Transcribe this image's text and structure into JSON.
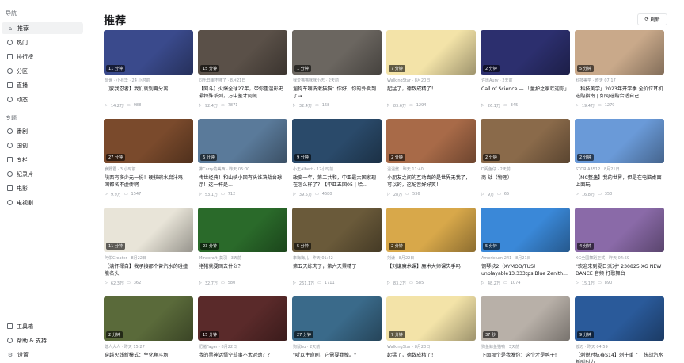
{
  "sidebar": {
    "nav_title": "导航",
    "nav": [
      {
        "label": "推荐",
        "icon": "home-icon"
      },
      {
        "label": "热门",
        "icon": "fire-icon"
      },
      {
        "label": "排行榜",
        "icon": "ranking-icon"
      },
      {
        "label": "分区",
        "icon": "category-icon"
      },
      {
        "label": "直播",
        "icon": "live-icon"
      },
      {
        "label": "动态",
        "icon": "activity-icon"
      }
    ],
    "zone_title": "专题",
    "zones": [
      {
        "label": "番剧",
        "icon": "anime-icon"
      },
      {
        "label": "国创",
        "icon": "guochuang-icon"
      },
      {
        "label": "专栏",
        "icon": "article-icon"
      },
      {
        "label": "纪录片",
        "icon": "documentary-icon"
      },
      {
        "label": "电影",
        "icon": "movie-icon"
      },
      {
        "label": "电视剧",
        "icon": "tv-icon"
      }
    ],
    "bottom": [
      {
        "label": "工具箱",
        "icon": "toolbox-icon"
      },
      {
        "label": "帮助 & 支持",
        "icon": "help-icon"
      },
      {
        "label": "设置",
        "icon": "settings-icon"
      }
    ]
  },
  "main": {
    "title": "推荐",
    "refresh_label": "刷新"
  },
  "videos": [
    {
      "duration": "11 分钟",
      "meta": "玩世 · 小孔华 · 24 小时前",
      "title": "【欧我忍者】我们就别再分离",
      "views": "14.2万",
      "danmaku": "988",
      "color": "#3a4a8c"
    },
    {
      "duration": "15 分钟",
      "meta": "同乐日审不够了 · 8月21日",
      "title": "【网斗】火爆全球27年，带你重温影史最特殊系列，万中鉴才阿凯...",
      "views": "92.4万",
      "danmaku": "7871",
      "color": "#5a5048"
    },
    {
      "duration": "1 分钟",
      "meta": "我爱猫猫咪咪小志 · 2天前",
      "title": "遛狗车嘴洗漱猫猫：你好，你的外卖到了→",
      "views": "32.4万",
      "danmaku": "168",
      "color": "#6b6660"
    },
    {
      "duration": "7 分钟",
      "meta": "WalkingStar · 8月20日",
      "title": "起猛了，德数成精了！",
      "views": "83.6万",
      "danmaku": "1294",
      "color": "#f3e3a8"
    },
    {
      "duration": "2 分钟",
      "meta": "许愿Aury · 2天前",
      "title": "Call of Science — 「量护之家欢迎你」",
      "views": "26.1万",
      "danmaku": "345",
      "color": "#2c2f6e"
    },
    {
      "duration": "5 分钟",
      "meta": "科技美学 · 昨天 07:17",
      "title": "「科技美学」2023年开学季 全价位耳机选购指南 | 如何选购合适自己...",
      "views": "19.4万",
      "danmaku": "1279",
      "color": "#c9a98a"
    },
    {
      "duration": "27 分钟",
      "meta": "食野君 · 3 小时前",
      "title": "陕西有多少元一份！硬核碗水腐汁鸡，国都名不虚传啊",
      "views": "9.9万",
      "danmaku": "1547",
      "color": "#7a4a2c"
    },
    {
      "duration": "6 分钟",
      "meta": "拂Carry的美西 · 昨天 05:00",
      "title": "传世经典！和山峡小国有头谁决战台球厅！这一杆是...",
      "views": "53.1万",
      "danmaku": "712",
      "color": "#5a7a9a"
    },
    {
      "duration": "9 分钟",
      "meta": "小王Albert · 12小时前",
      "title": "政变一年，第二共和，中亚最大国家现在怎么样了？【中亚五国05 | 哈...",
      "views": "39.5万",
      "danmaku": "4680",
      "color": "#2a4a6a"
    },
    {
      "duration": "2 分钟",
      "meta": "温温酱 · 昨天 11:40",
      "title": "小朋友之间的互动真的是世界无我了，可以的，这配音好好笑！",
      "views": "28万",
      "danmaku": "536",
      "color": "#a86a48"
    },
    {
      "duration": "2 分钟",
      "meta": "D阁鱼仔 · 2天前",
      "title": "商 战（物理）",
      "views": "9万",
      "danmaku": "65",
      "color": "#8a6a4a"
    },
    {
      "duration": "2 分钟",
      "meta": "STORIA3512 · 8月21日",
      "title": "【MC整蛊】我的世界，但是在电脑桌面上面玩",
      "views": "16.8万",
      "danmaku": "350",
      "color": "#6a9ad8"
    },
    {
      "duration": "11 分钟",
      "meta": "阿佑Creater · 8月22日",
      "title": "【满怀椰自】我承接那个曾汽水的碰撞能名头",
      "views": "62.3万",
      "danmaku": "362",
      "color": "#e8e4d8"
    },
    {
      "duration": "23 分钟",
      "meta": "Minecraft_莫羽 · 3天前",
      "title": "猪猪就要回去什么？",
      "views": "32.7万",
      "danmaku": "580",
      "color": "#2a6a2a"
    },
    {
      "duration": "5 分钟",
      "meta": "李梅梅儿 · 昨天 01:42",
      "title": "第五天练肉了，第六天累精了",
      "views": "261.1万",
      "danmaku": "1711",
      "color": "#6a5a3a"
    },
    {
      "duration": "2 分钟",
      "meta": "刘谦 · 8月22日",
      "title": "【刘谦魔术课】魔术大师课失手吗",
      "views": "83.2万",
      "danmaku": "585",
      "color": "#d8a84a"
    },
    {
      "duration": "5 分钟",
      "meta": "Americium-241 · 8月21日",
      "title": "钢琴块2（XYMOD/TUS）unplayable13.333tps Blue Zenith...",
      "views": "48.2万",
      "danmaku": "1074",
      "color": "#3a88d8"
    },
    {
      "duration": "4 分钟",
      "meta": "XG全国舞蹈正式 · 昨天 04:59",
      "title": "\"欢迎来到夏日派对\" 230825 XG NEW DANCE 音频 打歌舞台",
      "views": "15.1万",
      "danmaku": "890",
      "color": "#8a6aa8"
    },
    {
      "duration": "2 分钟",
      "meta": "建人大人 · 昨天 15:27",
      "title": "穿越火线新模式：生化角斗场",
      "views": "",
      "danmaku": "",
      "color": "#5a6a3a"
    },
    {
      "duration": "15 分钟",
      "meta": "肥猪Fager · 8月22日",
      "title": "我的黑神话悟空却事不太对劲？？",
      "views": "",
      "danmaku": "",
      "color": "#5a2a2a"
    },
    {
      "duration": "27 分钟",
      "meta": "狗鼠bu · 2天前",
      "title": "\"听以生命刷，它需要我掉。\"",
      "views": "",
      "danmaku": "",
      "color": "#3a6a8a"
    },
    {
      "duration": "7 分钟",
      "meta": "WalkingStar · 8月20日",
      "title": "起猛了，德数成精了！",
      "views": "",
      "danmaku": "",
      "color": "#f3e3a8"
    },
    {
      "duration": "37 秒",
      "meta": "狗鱼鲸鱼猫鸭 · 3天前",
      "title": "下面那个是我发你：这个才是鸭子!",
      "views": "",
      "danmaku": "",
      "color": "#b8b0a8"
    },
    {
      "duration": "9 分钟",
      "meta": "渡辺 · 昨天 04:59",
      "title": "【刺锐时抗赛S14】刺十重了，快战汽水新时时力",
      "views": "",
      "danmaku": "",
      "color": "#2a5a9a"
    }
  ]
}
